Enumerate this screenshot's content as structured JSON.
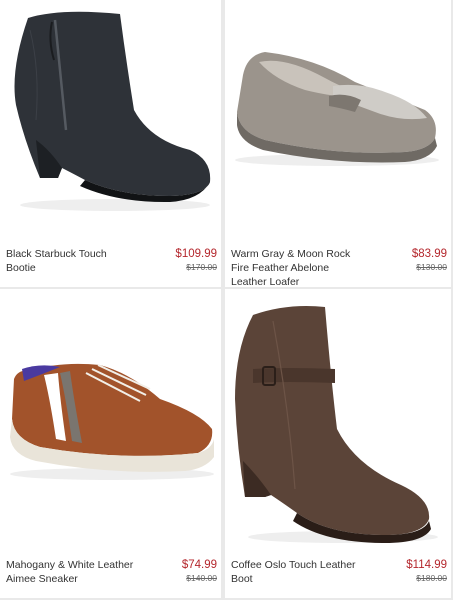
{
  "products": [
    {
      "name": "Black Starbuck Touch Bootie",
      "price": "$109.99",
      "original_price": "$170.00",
      "icon": "black-ankle-bootie"
    },
    {
      "name": "Warm Gray & Moon Rock Fire Feather Abelone Leather Loafer",
      "price": "$83.99",
      "original_price": "$130.00",
      "icon": "gray-leather-loafer"
    },
    {
      "name": "Mahogany & White Leather Aimee Sneaker",
      "price": "$74.99",
      "original_price": "$140.00",
      "icon": "brown-leather-sneaker"
    },
    {
      "name": "Coffee Oslo Touch Leather Boot",
      "price": "$114.99",
      "original_price": "$180.00",
      "icon": "brown-ankle-boot"
    }
  ]
}
